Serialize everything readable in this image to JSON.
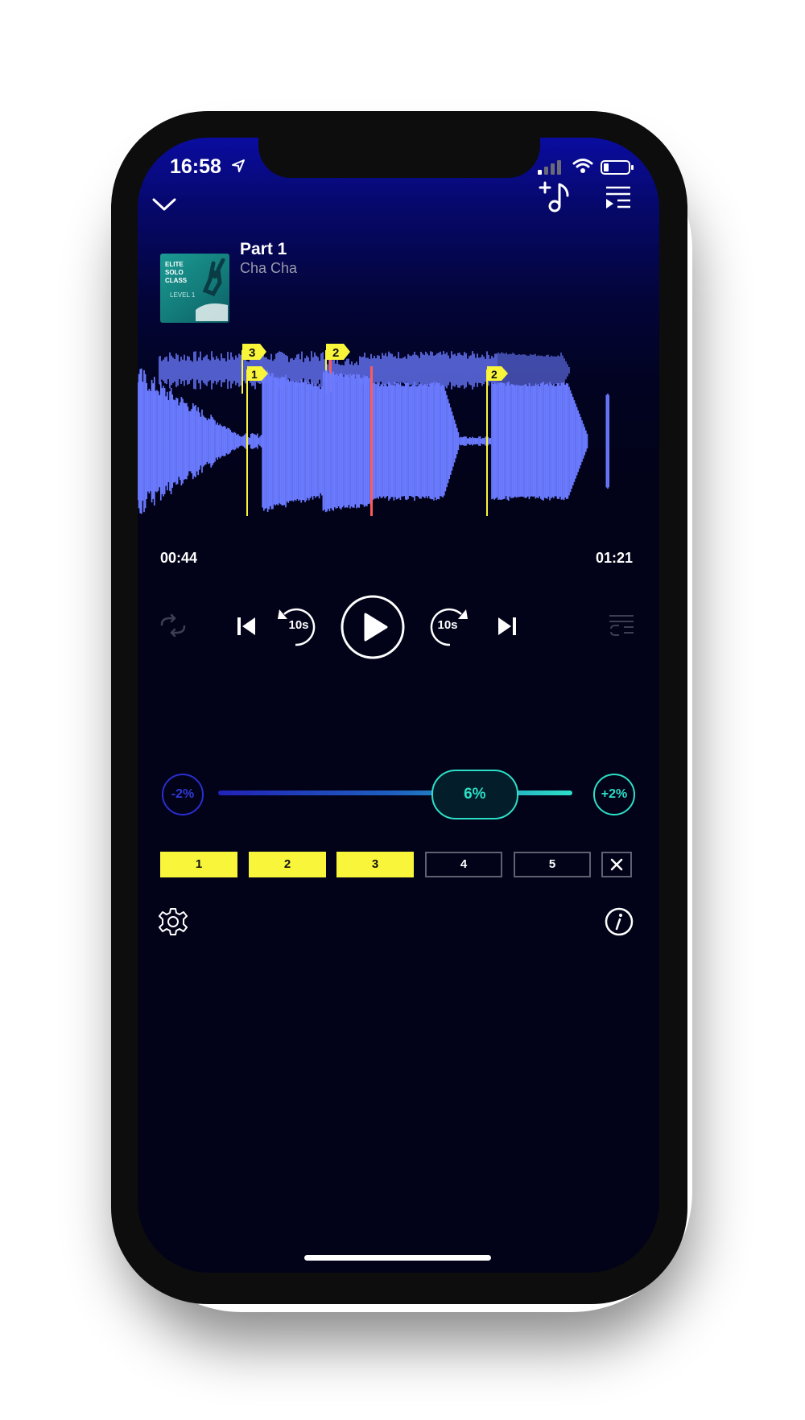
{
  "status_bar": {
    "time": "16:58"
  },
  "track": {
    "title": "Part 1",
    "artist": "Cha Cha",
    "cover_lines": [
      "ELITE",
      "SOLO",
      "CLASS"
    ],
    "cover_level": "LEVEL 1"
  },
  "overview_markers": [
    "3",
    "2"
  ],
  "detail_markers": [
    "1",
    "2"
  ],
  "playback": {
    "elapsed": "00:44",
    "duration": "01:21",
    "progress": 0.54
  },
  "skip": {
    "back_label": "10s",
    "forward_label": "10s"
  },
  "tempo": {
    "minus_label": "-2%",
    "plus_label": "+2%",
    "current": "6%",
    "level": 0.72
  },
  "loop_slots": [
    {
      "label": "1",
      "active": true
    },
    {
      "label": "2",
      "active": true
    },
    {
      "label": "3",
      "active": true
    },
    {
      "label": "4",
      "active": false
    },
    {
      "label": "5",
      "active": false
    }
  ],
  "colors": {
    "waveform": "#6b7bff",
    "marker": "#f9f53b",
    "playhead": "#ff5a5a",
    "tempo_accent": "#2cdfc7",
    "tempo_minus": "#2a2ed0"
  },
  "icons": {
    "collapse": "chevron-down-icon",
    "add_song": "add-music-icon",
    "queue": "playlist-icon",
    "repeat": "repeat-icon",
    "settings": "gear-icon",
    "info": "info-icon"
  }
}
